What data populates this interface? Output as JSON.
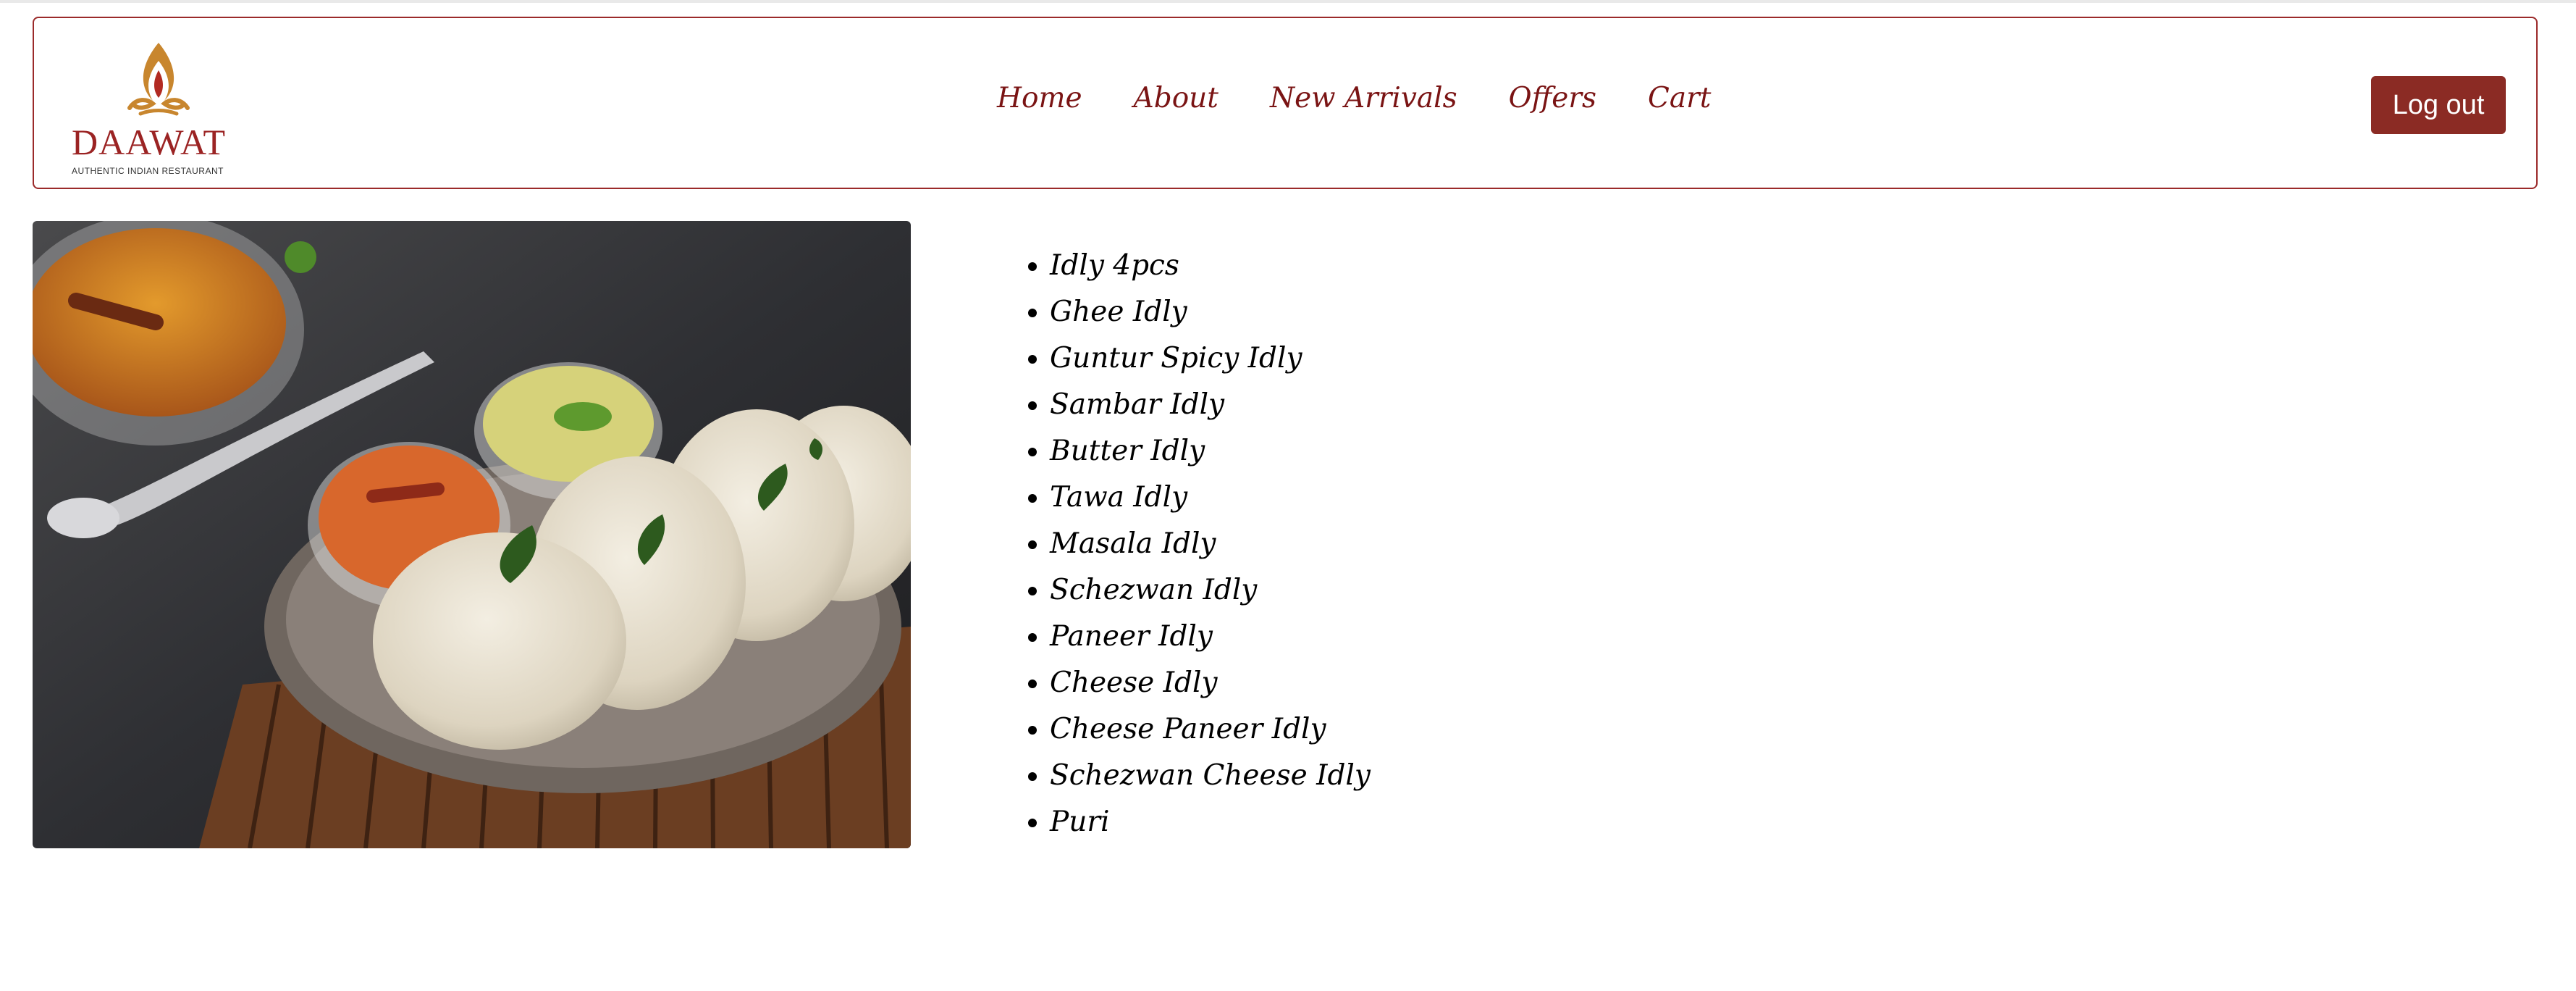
{
  "brand": {
    "name": "DAAWAT",
    "tagline": "AUTHENTIC INDIAN RESTAURANT"
  },
  "nav": {
    "links": [
      "Home",
      "About",
      "New Arrivals",
      "Offers",
      "Cart"
    ],
    "logout_label": "Log out"
  },
  "colors": {
    "brand_red": "#9b2a2a",
    "nav_text": "#7a1414",
    "button_bg": "#8b2b24",
    "logo_gold": "#c8862e"
  },
  "image": {
    "icon": "idly-plate-photo"
  },
  "menu": {
    "items": [
      "Idly 4pcs",
      "Ghee Idly",
      "Guntur Spicy Idly",
      "Sambar Idly",
      "Butter Idly",
      "Tawa Idly",
      "Masala Idly",
      "Schezwan Idly",
      "Paneer Idly",
      "Cheese Idly",
      "Cheese Paneer Idly",
      "Schezwan Cheese Idly",
      "Puri"
    ]
  }
}
